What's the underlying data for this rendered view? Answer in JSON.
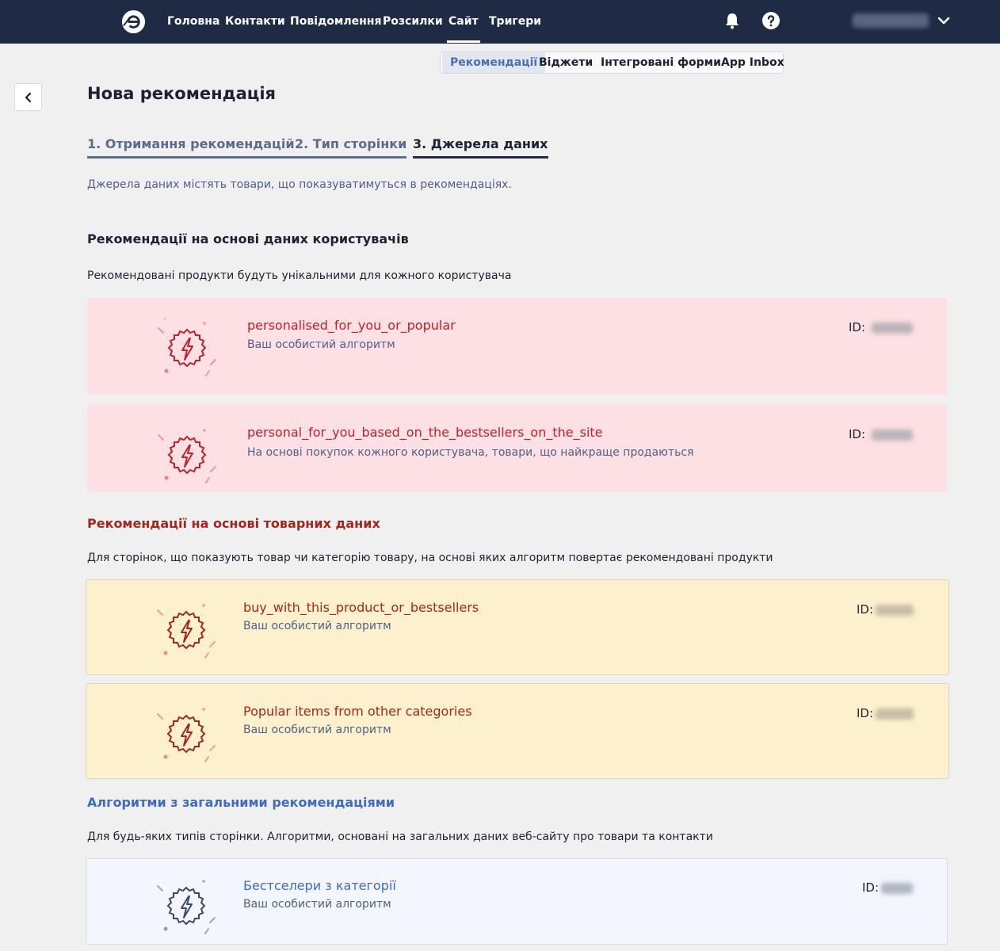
{
  "nav": {
    "items": [
      "Головна",
      "Контакти",
      "Повідомлення",
      "Розсилки",
      "Сайт",
      "Тригери"
    ],
    "active": "Сайт"
  },
  "subtabs": [
    "Рекомендації",
    "Віджети",
    "Інтегровані форми",
    "App Inbox"
  ],
  "page": {
    "title": "Нова рекомендація",
    "steps": [
      "1. Отримання рекомендацій",
      "2. Тип сторінки",
      "3. Джерела даних"
    ],
    "intro": "Джерела даних містять товари, що показуватимуться в рекомендаціях."
  },
  "sections": [
    {
      "title": "Рекомендації на основі даних користувачів",
      "desc": "Рекомендовані продукти будуть унікальними для кожного користувача",
      "color": "#1c2233",
      "cards": [
        {
          "name": "personalised_for_you_or_popular",
          "sub": "Ваш особистий алгоритм",
          "id_label": "ID:"
        },
        {
          "name": "personal_for_you_based_on_the_bestsellers_on_the_site",
          "sub": "На основі покупок кожного користувача, товари, що найкраще продаються",
          "id_label": "ID:"
        }
      ]
    },
    {
      "title": "Рекомендації на основі товарних даних",
      "desc": "Для сторінок, що показують товар чи категорію товару, на основі яких алгоритм повертає рекомендовані продукти",
      "color": "#a3271c",
      "cards": [
        {
          "name": "buy_with_this_product_or_bestsellers",
          "sub": "Ваш особистий алгоритм",
          "id_label": "ID:"
        },
        {
          "name": "Popular items from other categories",
          "sub": "Ваш особистий алгоритм",
          "id_label": "ID:"
        }
      ]
    },
    {
      "title": "Алгоритми з загальними рекомендаціями",
      "desc": "Для будь-яких типів сторінки. Алгоритми, основані на загальних даних веб-сайту про товари та контакти",
      "color": "#3e6cc4",
      "cards": [
        {
          "name": "Бестселери з категорії",
          "sub": "Ваш особистий алгоритм",
          "id_label": "ID:"
        }
      ]
    }
  ],
  "colors": {
    "navbar": "#1f2a44",
    "pink_card": "#fce0e4",
    "yellow_card": "#fdf1cd",
    "blue_card": "#f3f6fc",
    "red_accent": "#c0212b",
    "blue_accent": "#3e6cc4"
  },
  "icons": [
    "logo-icon",
    "bell-icon",
    "help-icon",
    "chevron-down-icon",
    "chevron-left-icon",
    "lightning-badge-icon"
  ]
}
